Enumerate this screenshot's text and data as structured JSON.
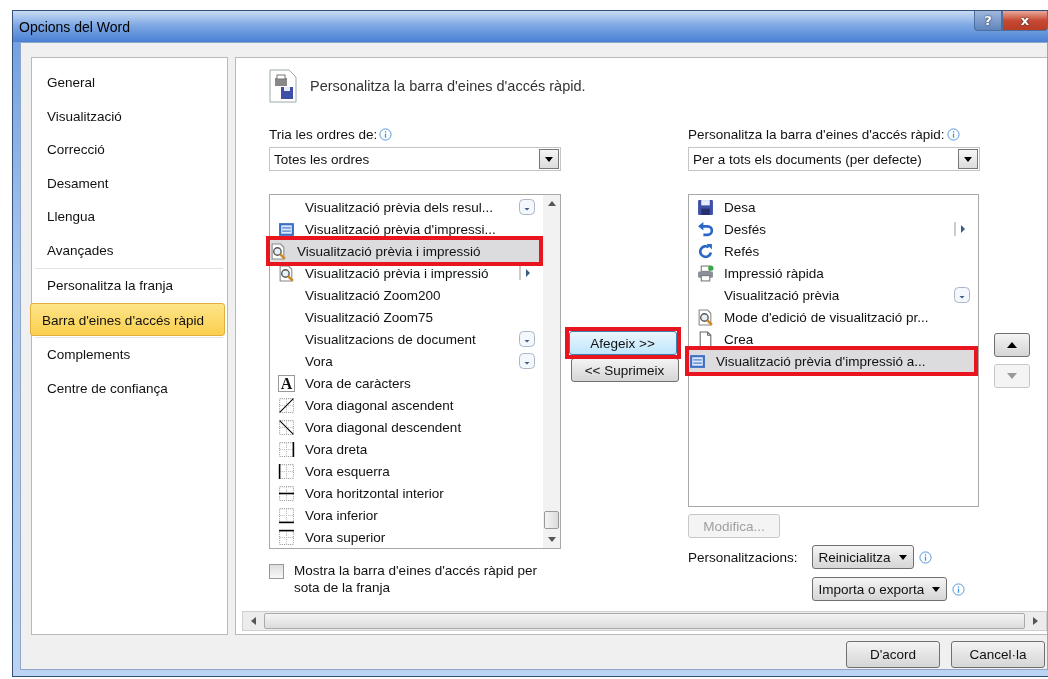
{
  "window": {
    "title": "Opcions del Word",
    "title_buttons": [
      {
        "kind": "help",
        "label": "?"
      },
      {
        "kind": "close",
        "label": "x"
      }
    ]
  },
  "sidebar": {
    "sections": [
      {
        "items": [
          {
            "label": "General",
            "selected": false
          },
          {
            "label": "Visualització",
            "selected": false
          },
          {
            "label": "Correcció",
            "selected": false
          },
          {
            "label": "Desament",
            "selected": false
          },
          {
            "label": "Llengua",
            "selected": false
          },
          {
            "label": "Avançades",
            "selected": false
          }
        ]
      },
      {
        "items": [
          {
            "label": "Personalitza la franja",
            "selected": false
          },
          {
            "label": "Barra d'eines d'accés ràpid",
            "selected": true
          }
        ]
      },
      {
        "items": [
          {
            "label": "Complements",
            "selected": false
          },
          {
            "label": "Centre de confiança",
            "selected": false
          }
        ]
      }
    ]
  },
  "heading": "Personalitza la barra d'eines d'accés ràpid.",
  "commands": {
    "label": "Tria les ordres de:",
    "dropdown": "Totes les ordres",
    "items": [
      {
        "label": "Visualització prèvia dels resul...",
        "kind": "none",
        "gallery": true,
        "selected": false,
        "highlighted": false
      },
      {
        "label": "Visualització prèvia d'impressi...",
        "kind": "screen",
        "selected": false,
        "highlighted": false
      },
      {
        "label": "Visualització prèvia i impressió",
        "kind": "magnifier",
        "selected": true,
        "highlighted": true
      },
      {
        "label": "Visualització prèvia i impressió",
        "kind": "magnifier",
        "submenu": true,
        "selected": false,
        "highlighted": false
      },
      {
        "label": "Visualització Zoom200",
        "kind": "none",
        "selected": false,
        "highlighted": false
      },
      {
        "label": "Visualització Zoom75",
        "kind": "none",
        "selected": false,
        "highlighted": false
      },
      {
        "label": "Visualitzacions de document",
        "kind": "none",
        "gallery": true,
        "selected": false,
        "highlighted": false
      },
      {
        "label": "Vora",
        "kind": "none",
        "gallery": true,
        "selected": false,
        "highlighted": false
      },
      {
        "label": "Vora de caràcters",
        "kind": "glyph",
        "glyph": "A",
        "selected": false,
        "highlighted": false
      },
      {
        "label": "Vora diagonal ascendent",
        "kind": "border-diag-up",
        "selected": false,
        "highlighted": false
      },
      {
        "label": "Vora diagonal descendent",
        "kind": "border-diag-down",
        "selected": false,
        "highlighted": false
      },
      {
        "label": "Vora dreta",
        "kind": "border-right",
        "selected": false,
        "highlighted": false
      },
      {
        "label": "Vora esquerra",
        "kind": "border-left",
        "selected": false,
        "highlighted": false
      },
      {
        "label": "Vora horitzontal interior",
        "kind": "border-inner-h",
        "selected": false,
        "highlighted": false
      },
      {
        "label": "Vora inferior",
        "kind": "border-bottom",
        "selected": false,
        "highlighted": false
      },
      {
        "label": "Vora superior",
        "kind": "border-top",
        "selected": false,
        "highlighted": false
      }
    ],
    "checkbox": {
      "label": "Mostra la barra d'eines d'accés ràpid per sota de la franja",
      "checked": false
    }
  },
  "transfer": [
    {
      "label": "Afegeix >>",
      "highlighted": true
    },
    {
      "label": "<< Suprimeix",
      "highlighted": false
    }
  ],
  "toolbar": {
    "label": "Personalitza la barra d'eines d'accés ràpid:",
    "dropdown": "Per a tots els documents (per defecte)",
    "items": [
      {
        "label": "Desa",
        "kind": "floppy",
        "selected": false,
        "highlighted": false
      },
      {
        "label": "Desfés",
        "kind": "undo",
        "submenu": true,
        "selected": false,
        "highlighted": false
      },
      {
        "label": "Refés",
        "kind": "redo",
        "selected": false,
        "highlighted": false
      },
      {
        "label": "Impressió ràpida",
        "kind": "printer",
        "selected": false,
        "highlighted": false
      },
      {
        "label": "Visualització prèvia",
        "kind": "none",
        "gallery": true,
        "selected": false,
        "highlighted": false
      },
      {
        "label": "Mode d'edició de visualització pr...",
        "kind": "magnifier",
        "selected": false,
        "highlighted": false
      },
      {
        "label": "Crea",
        "kind": "page",
        "selected": false,
        "highlighted": false
      },
      {
        "label": "Visualització prèvia d'impressió a...",
        "kind": "screen",
        "selected": true,
        "highlighted": true
      }
    ],
    "move_buttons": [
      {
        "kind": "up",
        "disabled": false
      },
      {
        "kind": "down",
        "disabled": true
      }
    ],
    "modify": {
      "label": "Modifica...",
      "disabled": true
    },
    "customizations_label": "Personalitzacions:",
    "menu_buttons": [
      "Reinicialitza",
      "Importa o exporta"
    ]
  },
  "buttons": [
    "D'acord",
    "Cancel·la"
  ]
}
